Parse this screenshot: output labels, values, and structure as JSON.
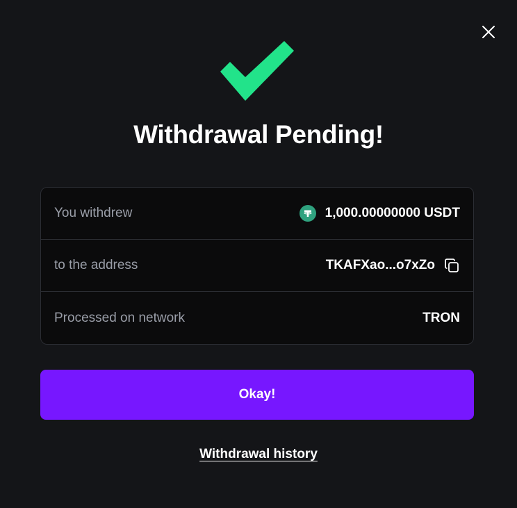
{
  "modal": {
    "title": "Withdrawal Pending!",
    "colors": {
      "background": "#141518",
      "check": "#22e38a",
      "accent": "#7717ff",
      "tether": "#2fa27f"
    },
    "icons": {
      "close": "close-icon",
      "status": "checkmark-icon",
      "currency": "tether-icon",
      "copy": "copy-icon"
    }
  },
  "details": {
    "amount_label": "You withdrew",
    "amount_value": "1,000.00000000 USDT",
    "address_label": "to the address",
    "address_value": "TKAFXao...o7xZo",
    "network_label": "Processed on network",
    "network_value": "TRON"
  },
  "actions": {
    "okay_label": "Okay!",
    "history_label": "Withdrawal history"
  }
}
